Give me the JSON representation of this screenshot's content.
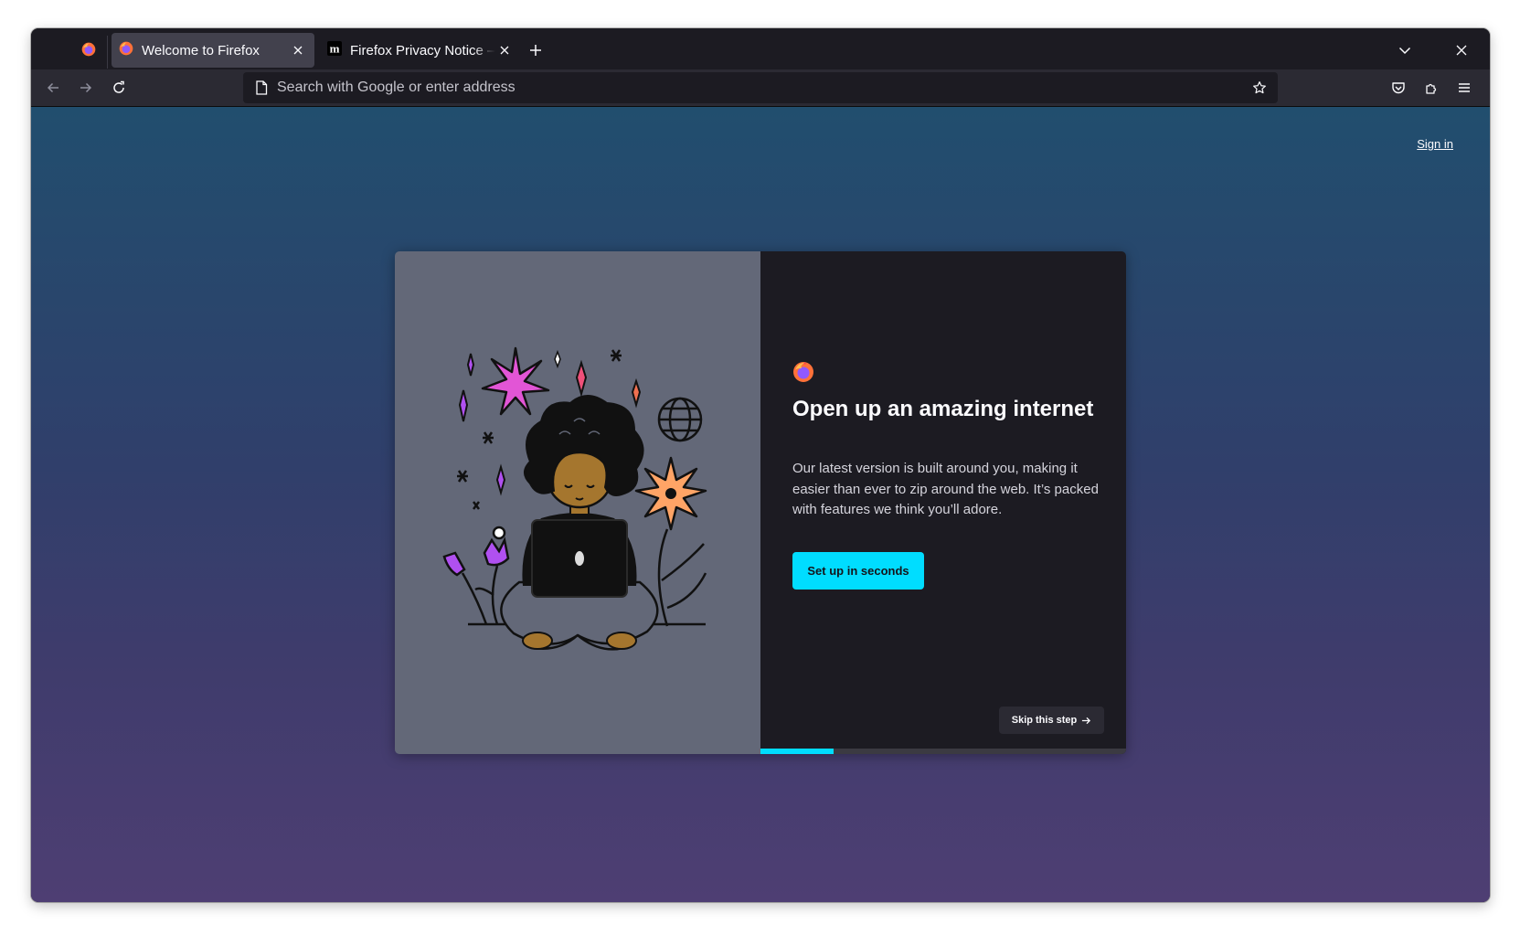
{
  "browser": {
    "tabs": [
      {
        "title": "Welcome to Firefox",
        "active": true,
        "icon": "firefox-icon"
      },
      {
        "title": "Firefox Privacy Notice — Mozilla",
        "active": false,
        "icon": "mozilla-m-icon"
      }
    ],
    "pinned_tab_icon": "firefox-icon"
  },
  "urlbar": {
    "placeholder": "Search with Google or enter address",
    "value": ""
  },
  "page": {
    "sign_in": "Sign in",
    "title": "Open up an amazing internet",
    "subtitle": "Our latest version is built around you, making it easier than ever to zip around the web. It’s packed with features we think you’ll adore.",
    "primary_button": "Set up in seconds",
    "skip_button": "Skip this step",
    "progress": 0.2
  },
  "colors": {
    "accent": "#00ddff",
    "card_dark": "#1c1b22",
    "card_illustration_bg": "#636878"
  }
}
